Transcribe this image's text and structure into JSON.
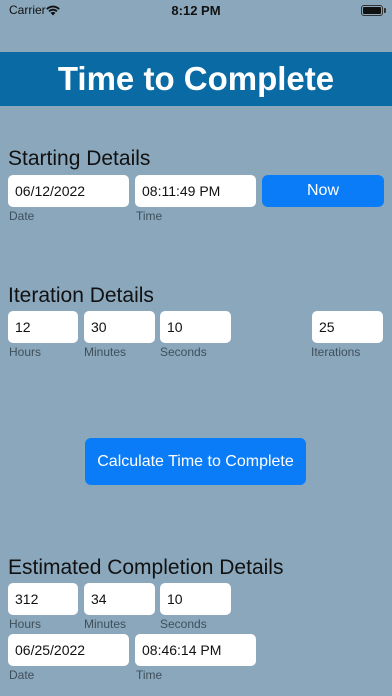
{
  "status_bar": {
    "carrier": "Carrier",
    "time": "8:12 PM"
  },
  "header": {
    "title": "Time to Complete"
  },
  "starting": {
    "title": "Starting Details",
    "date_value": "06/12/2022",
    "time_value": "08:11:49 PM",
    "now_label": "Now",
    "date_caption": "Date",
    "time_caption": "Time"
  },
  "iteration": {
    "title": "Iteration Details",
    "hours_value": "12",
    "minutes_value": "30",
    "seconds_value": "10",
    "iterations_value": "25",
    "hours_caption": "Hours",
    "minutes_caption": "Minutes",
    "seconds_caption": "Seconds",
    "iterations_caption": "Iterations"
  },
  "calculate": {
    "label": "Calculate Time to Complete"
  },
  "completion": {
    "title": "Estimated Completion Details",
    "hours_value": "312",
    "minutes_value": "34",
    "seconds_value": "10",
    "hours_caption": "Hours",
    "minutes_caption": "Minutes",
    "seconds_caption": "Seconds",
    "date_value": "06/25/2022",
    "time_value": "08:46:14 PM",
    "date_caption": "Date",
    "time_caption": "Time"
  }
}
